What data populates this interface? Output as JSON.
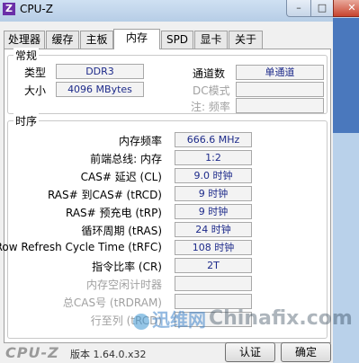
{
  "window": {
    "title": "CPU-Z",
    "logo": "Z",
    "min": "–",
    "max": "□",
    "close": "✕"
  },
  "tabs": [
    "处理器",
    "缓存",
    "主板",
    "内存",
    "SPD",
    "显卡",
    "关于"
  ],
  "general": {
    "title": "常规",
    "type_label": "类型",
    "type_value": "DDR3",
    "size_label": "大小",
    "size_value": "4096 MBytes",
    "channels_label": "通道数",
    "channels_value": "单通道",
    "dc_label": "DC模式",
    "nb_label": "注: 频率"
  },
  "timings": {
    "title": "时序",
    "rows": [
      {
        "label": "内存频率",
        "value": "666.6 MHz"
      },
      {
        "label": "前端总线: 内存",
        "value": "1:2"
      },
      {
        "label": "CAS# 延迟 (CL)",
        "value": "9.0 时钟"
      },
      {
        "label": "RAS# 到CAS# (tRCD)",
        "value": "9 时钟"
      },
      {
        "label": "RAS# 预充电 (tRP)",
        "value": "9 时钟"
      },
      {
        "label": "循环周期 (tRAS)",
        "value": "24 时钟"
      },
      {
        "label": "Row Refresh Cycle Time (tRFC)",
        "value": "108 时钟"
      },
      {
        "label": "指令比率 (CR)",
        "value": "2T"
      },
      {
        "label": "内存空闲计时器",
        "value": ""
      },
      {
        "label": "总CAS号 (tRDRAM)",
        "value": ""
      },
      {
        "label": "行至列 (tRCD)",
        "value": ""
      }
    ]
  },
  "bottom": {
    "brand": "CPU-Z",
    "version": "版本 1.64.0.x32",
    "validate": "认证",
    "ok": "确定"
  },
  "watermark": {
    "text1": "迅维网",
    "text2": "Chinafix.com"
  },
  "colors": {
    "value_text": "#1d2a8a",
    "tab_border": "#a0a0a0"
  }
}
